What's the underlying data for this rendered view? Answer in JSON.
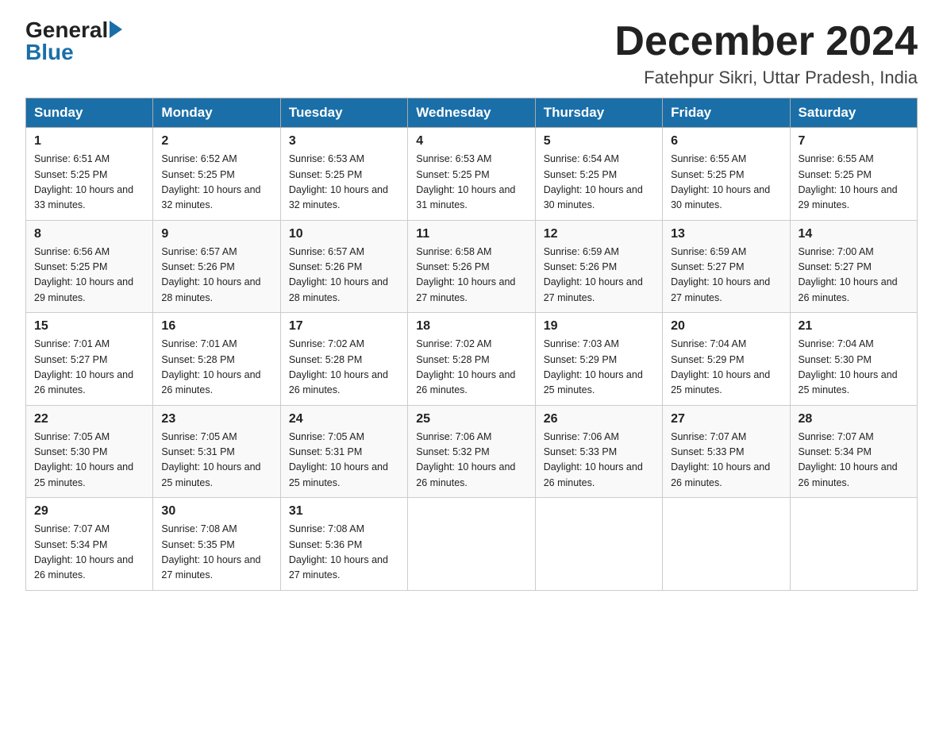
{
  "header": {
    "logo_general": "General",
    "logo_blue": "Blue",
    "month_title": "December 2024",
    "location": "Fatehpur Sikri, Uttar Pradesh, India"
  },
  "weekdays": [
    "Sunday",
    "Monday",
    "Tuesday",
    "Wednesday",
    "Thursday",
    "Friday",
    "Saturday"
  ],
  "weeks": [
    [
      {
        "day": "1",
        "sunrise": "6:51 AM",
        "sunset": "5:25 PM",
        "daylight": "10 hours and 33 minutes."
      },
      {
        "day": "2",
        "sunrise": "6:52 AM",
        "sunset": "5:25 PM",
        "daylight": "10 hours and 32 minutes."
      },
      {
        "day": "3",
        "sunrise": "6:53 AM",
        "sunset": "5:25 PM",
        "daylight": "10 hours and 32 minutes."
      },
      {
        "day": "4",
        "sunrise": "6:53 AM",
        "sunset": "5:25 PM",
        "daylight": "10 hours and 31 minutes."
      },
      {
        "day": "5",
        "sunrise": "6:54 AM",
        "sunset": "5:25 PM",
        "daylight": "10 hours and 30 minutes."
      },
      {
        "day": "6",
        "sunrise": "6:55 AM",
        "sunset": "5:25 PM",
        "daylight": "10 hours and 30 minutes."
      },
      {
        "day": "7",
        "sunrise": "6:55 AM",
        "sunset": "5:25 PM",
        "daylight": "10 hours and 29 minutes."
      }
    ],
    [
      {
        "day": "8",
        "sunrise": "6:56 AM",
        "sunset": "5:25 PM",
        "daylight": "10 hours and 29 minutes."
      },
      {
        "day": "9",
        "sunrise": "6:57 AM",
        "sunset": "5:26 PM",
        "daylight": "10 hours and 28 minutes."
      },
      {
        "day": "10",
        "sunrise": "6:57 AM",
        "sunset": "5:26 PM",
        "daylight": "10 hours and 28 minutes."
      },
      {
        "day": "11",
        "sunrise": "6:58 AM",
        "sunset": "5:26 PM",
        "daylight": "10 hours and 27 minutes."
      },
      {
        "day": "12",
        "sunrise": "6:59 AM",
        "sunset": "5:26 PM",
        "daylight": "10 hours and 27 minutes."
      },
      {
        "day": "13",
        "sunrise": "6:59 AM",
        "sunset": "5:27 PM",
        "daylight": "10 hours and 27 minutes."
      },
      {
        "day": "14",
        "sunrise": "7:00 AM",
        "sunset": "5:27 PM",
        "daylight": "10 hours and 26 minutes."
      }
    ],
    [
      {
        "day": "15",
        "sunrise": "7:01 AM",
        "sunset": "5:27 PM",
        "daylight": "10 hours and 26 minutes."
      },
      {
        "day": "16",
        "sunrise": "7:01 AM",
        "sunset": "5:28 PM",
        "daylight": "10 hours and 26 minutes."
      },
      {
        "day": "17",
        "sunrise": "7:02 AM",
        "sunset": "5:28 PM",
        "daylight": "10 hours and 26 minutes."
      },
      {
        "day": "18",
        "sunrise": "7:02 AM",
        "sunset": "5:28 PM",
        "daylight": "10 hours and 26 minutes."
      },
      {
        "day": "19",
        "sunrise": "7:03 AM",
        "sunset": "5:29 PM",
        "daylight": "10 hours and 25 minutes."
      },
      {
        "day": "20",
        "sunrise": "7:04 AM",
        "sunset": "5:29 PM",
        "daylight": "10 hours and 25 minutes."
      },
      {
        "day": "21",
        "sunrise": "7:04 AM",
        "sunset": "5:30 PM",
        "daylight": "10 hours and 25 minutes."
      }
    ],
    [
      {
        "day": "22",
        "sunrise": "7:05 AM",
        "sunset": "5:30 PM",
        "daylight": "10 hours and 25 minutes."
      },
      {
        "day": "23",
        "sunrise": "7:05 AM",
        "sunset": "5:31 PM",
        "daylight": "10 hours and 25 minutes."
      },
      {
        "day": "24",
        "sunrise": "7:05 AM",
        "sunset": "5:31 PM",
        "daylight": "10 hours and 25 minutes."
      },
      {
        "day": "25",
        "sunrise": "7:06 AM",
        "sunset": "5:32 PM",
        "daylight": "10 hours and 26 minutes."
      },
      {
        "day": "26",
        "sunrise": "7:06 AM",
        "sunset": "5:33 PM",
        "daylight": "10 hours and 26 minutes."
      },
      {
        "day": "27",
        "sunrise": "7:07 AM",
        "sunset": "5:33 PM",
        "daylight": "10 hours and 26 minutes."
      },
      {
        "day": "28",
        "sunrise": "7:07 AM",
        "sunset": "5:34 PM",
        "daylight": "10 hours and 26 minutes."
      }
    ],
    [
      {
        "day": "29",
        "sunrise": "7:07 AM",
        "sunset": "5:34 PM",
        "daylight": "10 hours and 26 minutes."
      },
      {
        "day": "30",
        "sunrise": "7:08 AM",
        "sunset": "5:35 PM",
        "daylight": "10 hours and 27 minutes."
      },
      {
        "day": "31",
        "sunrise": "7:08 AM",
        "sunset": "5:36 PM",
        "daylight": "10 hours and 27 minutes."
      },
      null,
      null,
      null,
      null
    ]
  ]
}
